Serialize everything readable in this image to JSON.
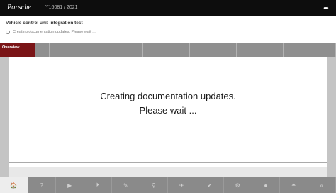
{
  "header": {
    "brand": "Porsche",
    "vin_info": "Y16081 / 2021",
    "top_icon": "export-icon"
  },
  "page": {
    "title": "Vehicle control unit integration test",
    "status": "Creating documentation updates. Please wait ..."
  },
  "tabs": [
    {
      "label": "Overview",
      "active": true
    },
    {
      "label": "",
      "active": false
    },
    {
      "label": "",
      "active": false
    },
    {
      "label": "",
      "active": false
    },
    {
      "label": "",
      "active": false
    },
    {
      "label": "",
      "active": false
    },
    {
      "label": "",
      "active": false
    },
    {
      "label": "",
      "active": false
    }
  ],
  "main": {
    "message_line1": "Creating documentation updates.",
    "message_line2": "Please wait ..."
  },
  "toolbar": {
    "buttons": [
      {
        "icon": "home-icon",
        "glyph": "🏠",
        "active": true
      },
      {
        "icon": "help-icon",
        "glyph": "?"
      },
      {
        "icon": "play-icon",
        "glyph": "▶"
      },
      {
        "icon": "forward-icon",
        "glyph": "⏵"
      },
      {
        "icon": "edit-icon",
        "glyph": "✎"
      },
      {
        "icon": "filter-icon",
        "glyph": "⚲"
      },
      {
        "icon": "tools-icon",
        "glyph": "✈"
      },
      {
        "icon": "check-icon",
        "glyph": "✔"
      },
      {
        "icon": "settings-icon",
        "glyph": "⚙"
      },
      {
        "icon": "info-icon",
        "glyph": "●"
      },
      {
        "icon": "up-icon",
        "glyph": "⏶"
      },
      {
        "icon": "back-icon",
        "glyph": "«"
      },
      {
        "icon": "next-icon",
        "glyph": "»"
      }
    ]
  }
}
